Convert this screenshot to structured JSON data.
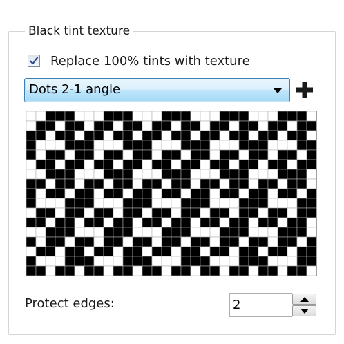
{
  "group": {
    "title": "Black tint texture"
  },
  "checkbox": {
    "label": "Replace 100% tints with texture",
    "checked": true
  },
  "dropdown": {
    "selected": "Dots 2-1 angle"
  },
  "add_button": {
    "icon": "plus-icon"
  },
  "pattern": {
    "columns": 30,
    "rows": 17,
    "cell_on_color": "#000000",
    "cell_off_color": "#ffffff",
    "grid_color": "#b0b0b0",
    "bitmap": [
      "001110001110001110001110001110",
      "011011011011011011011011011011",
      "110110110110110110110110110110",
      "100011100011100011100011100011",
      "101101101101101101101101101101",
      "011011011011011011011011011011",
      "001110001110001110001110001110",
      "110110110110110110110110110110",
      "101101101101101101101101101101",
      "100011100011100011100011100011",
      "011011011011011011011011011011",
      "110110110110110110110110110110",
      "001110001110001110001110001110",
      "101101101101101101101101101101",
      "011011011011011011011011011011",
      "100011100011100011100011100011",
      "110110110110110110110110110110"
    ]
  },
  "protect_edges": {
    "label": "Protect edges:",
    "value": "2"
  }
}
